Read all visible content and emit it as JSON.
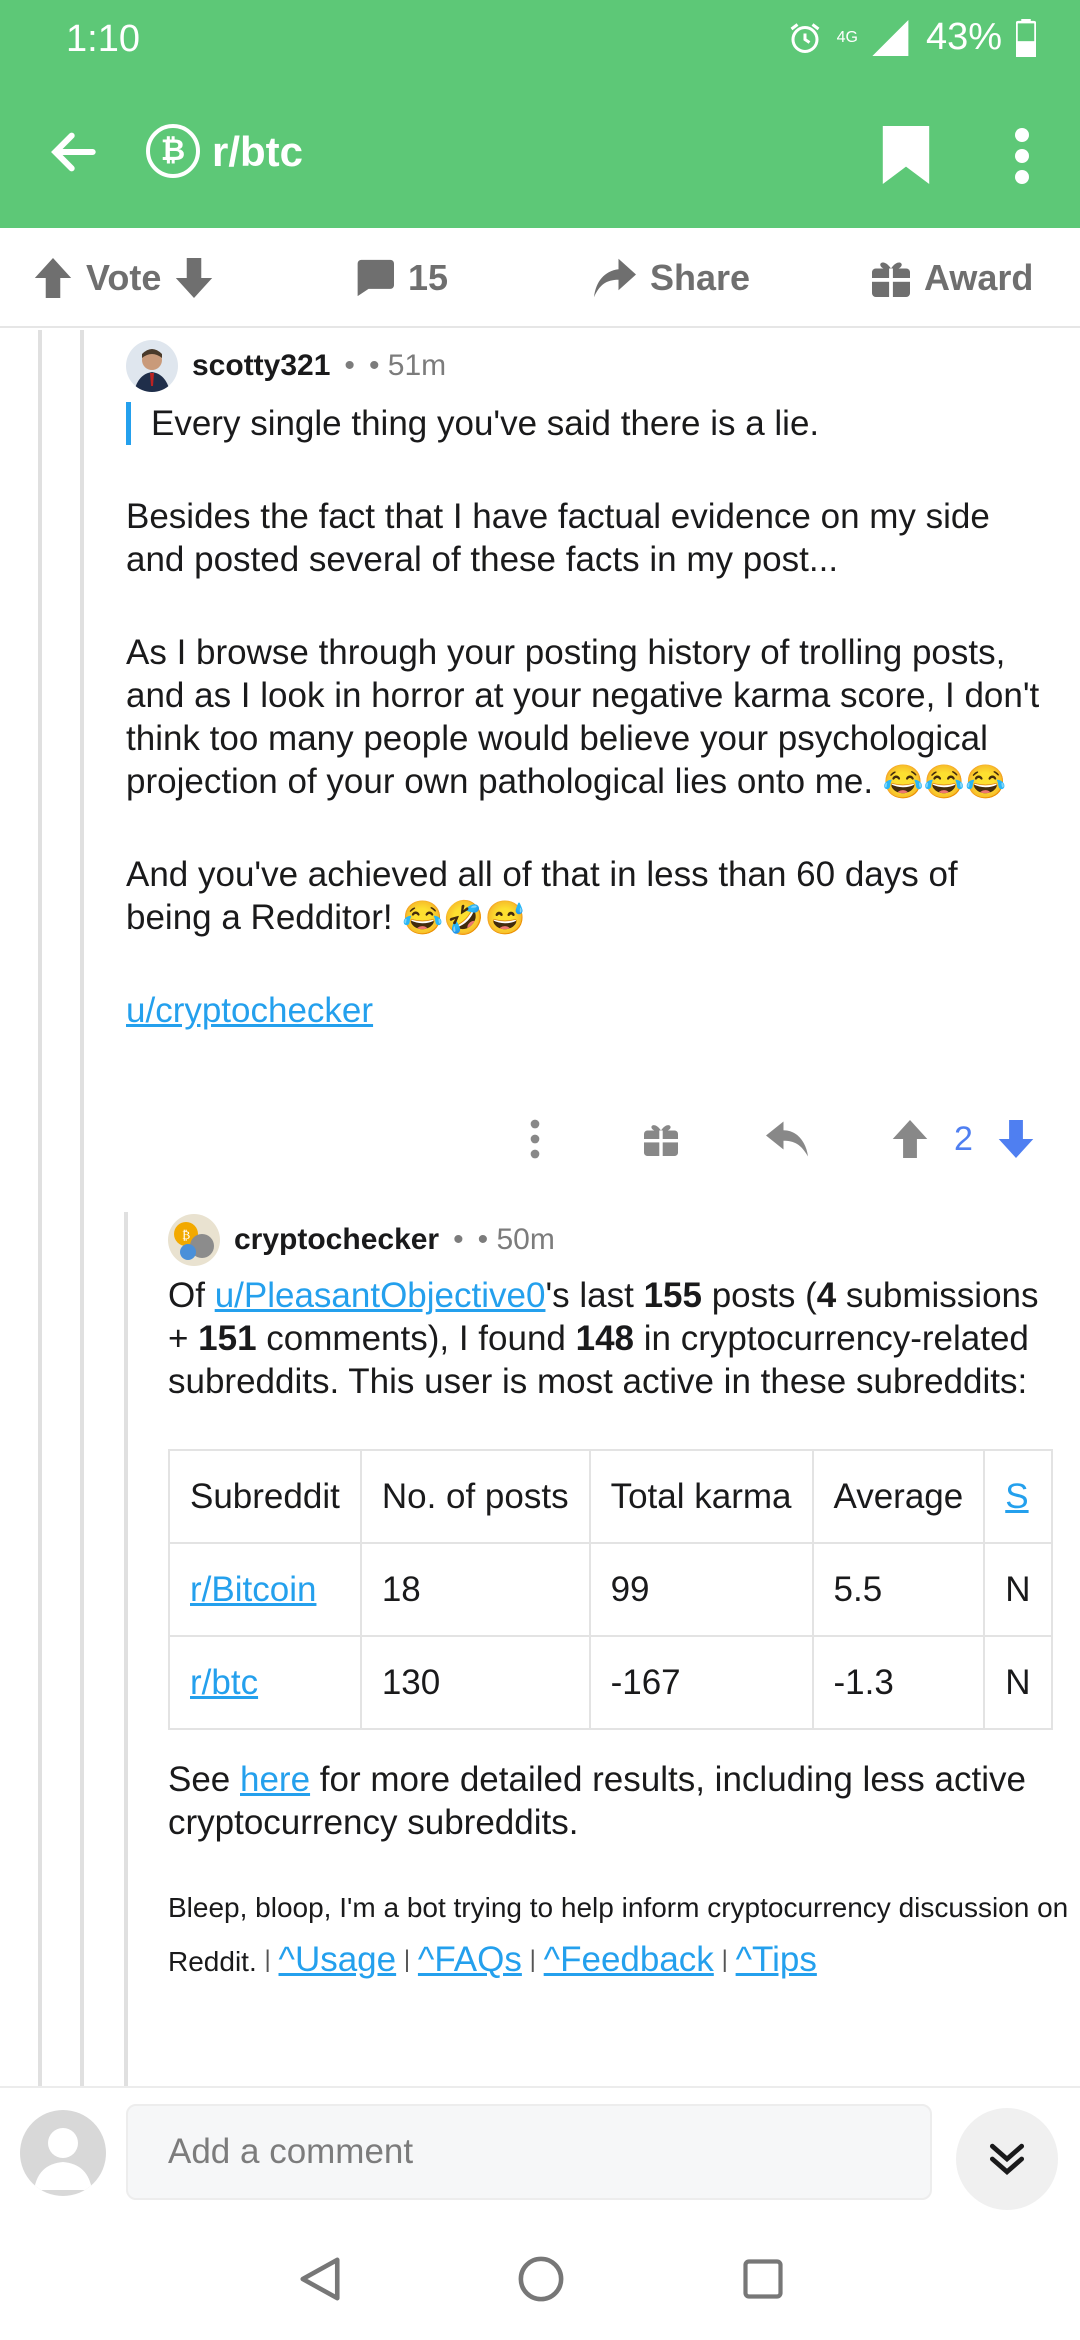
{
  "status": {
    "time": "1:10",
    "network": "4G",
    "battery": "43%"
  },
  "header": {
    "subreddit": "r/btc"
  },
  "actions": {
    "vote": "Vote",
    "comments": "15",
    "share": "Share",
    "award": "Award"
  },
  "comment1": {
    "username": "scotty321",
    "time": "51m",
    "quote": "Every single thing you've said there is a lie.",
    "para1": "Besides the fact that I have factual evidence on my side and posted several of these facts in my post...",
    "para2": "As I browse through your posting history of trolling posts, and as I look in horror at your negative karma score, I don't think too many people would believe your psychological projection of your own pathological lies onto me.",
    "para2_emoji": "😂😂😂",
    "para3": "And you've achieved all of that in less than 60 days of being a Redditor!",
    "para3_emoji": "😂🤣😅",
    "mention": "u/cryptochecker",
    "score": "2"
  },
  "comment2": {
    "username": "cryptochecker",
    "time": "50m",
    "intro_of": "Of ",
    "user_link": "u/PleasantObjective0",
    "intro_a": "'s last ",
    "posts_total": "155",
    "intro_b": " posts (",
    "submissions": "4",
    "intro_c": " submissions + ",
    "comments": "151",
    "intro_d": " comments), I found ",
    "found": "148",
    "intro_e": " in cryptocurrency-related subreddits. This user is most active in these subreddits:",
    "table": {
      "headers": [
        "Subreddit",
        "No. of posts",
        "Total karma",
        "Average",
        "S"
      ],
      "rows": [
        [
          "r/Bitcoin",
          "18",
          "99",
          "5.5",
          "N"
        ],
        [
          "r/btc",
          "130",
          "-167",
          "-1.3",
          "N"
        ]
      ]
    },
    "see": "See ",
    "here": "here",
    "see_rest": " for more detailed results, including less active cryptocurrency subreddits.",
    "bot_note": "Bleep, bloop, I'm a bot trying to help inform cryptocurrency discussion on Reddit.",
    "links": [
      "^Usage",
      "^FAQs",
      "^Feedback",
      "^Tips"
    ]
  },
  "composer": {
    "placeholder": "Add a comment"
  },
  "colors": {
    "header": "#5dc877",
    "link": "#24a0ed",
    "upvote": "#888888",
    "downvote": "#4f7ff1"
  }
}
